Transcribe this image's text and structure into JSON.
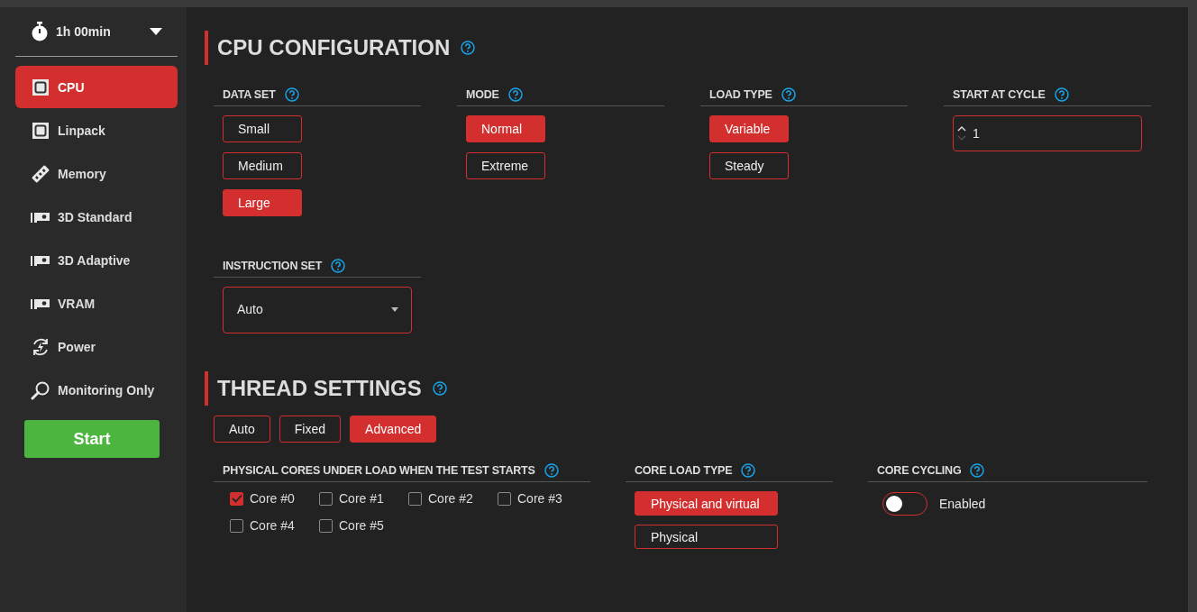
{
  "sidebar": {
    "timer": "1h 00min",
    "items": [
      {
        "label": "CPU",
        "kind": "chip",
        "selected": true
      },
      {
        "label": "Linpack",
        "kind": "chip",
        "selected": false
      },
      {
        "label": "Memory",
        "kind": "memory",
        "selected": false
      },
      {
        "label": "3D Standard",
        "kind": "gpu",
        "selected": false
      },
      {
        "label": "3D Adaptive",
        "kind": "gpu",
        "selected": false
      },
      {
        "label": "VRAM",
        "kind": "gpu",
        "selected": false
      },
      {
        "label": "Power",
        "kind": "power",
        "selected": false
      },
      {
        "label": "Monitoring Only",
        "kind": "magnifier",
        "selected": false
      }
    ],
    "start_button": "Start"
  },
  "cpu_configuration": {
    "title": "CPU CONFIGURATION",
    "groups": [
      {
        "kind": "options",
        "label": "DATA SET",
        "options": [
          {
            "label": "Small",
            "selected": false
          },
          {
            "label": "Medium",
            "selected": false
          },
          {
            "label": "Large",
            "selected": true
          }
        ]
      },
      {
        "kind": "options",
        "label": "MODE",
        "options": [
          {
            "label": "Normal",
            "selected": true
          },
          {
            "label": "Extreme",
            "selected": false
          }
        ]
      },
      {
        "kind": "options",
        "label": "LOAD TYPE",
        "options": [
          {
            "label": "Variable",
            "selected": true
          },
          {
            "label": "Steady",
            "selected": false
          }
        ]
      },
      {
        "kind": "number",
        "label": "START AT CYCLE",
        "value": "1"
      },
      {
        "kind": "dropdown",
        "label": "INSTRUCTION SET",
        "value": "Auto"
      }
    ]
  },
  "thread_settings": {
    "title": "THREAD SETTINGS",
    "modes": [
      {
        "label": "Auto",
        "selected": false
      },
      {
        "label": "Fixed",
        "selected": false
      },
      {
        "label": "Advanced",
        "selected": true
      }
    ],
    "groups": [
      {
        "kind": "checkboxes",
        "label": "PHYSICAL CORES UNDER LOAD WHEN THE TEST STARTS",
        "items": [
          {
            "label": "Core #0",
            "checked": true
          },
          {
            "label": "Core #1",
            "checked": false
          },
          {
            "label": "Core #2",
            "checked": false
          },
          {
            "label": "Core #3",
            "checked": false
          },
          {
            "label": "Core #4",
            "checked": false
          },
          {
            "label": "Core #5",
            "checked": false
          }
        ]
      },
      {
        "kind": "options",
        "label": "CORE LOAD TYPE",
        "options": [
          {
            "label": "Physical and virtual",
            "selected": true
          },
          {
            "label": "Physical",
            "selected": false
          }
        ]
      },
      {
        "kind": "toggle",
        "label": "CORE CYCLING",
        "toggle": {
          "label": "Enabled",
          "on": false
        }
      }
    ]
  }
}
